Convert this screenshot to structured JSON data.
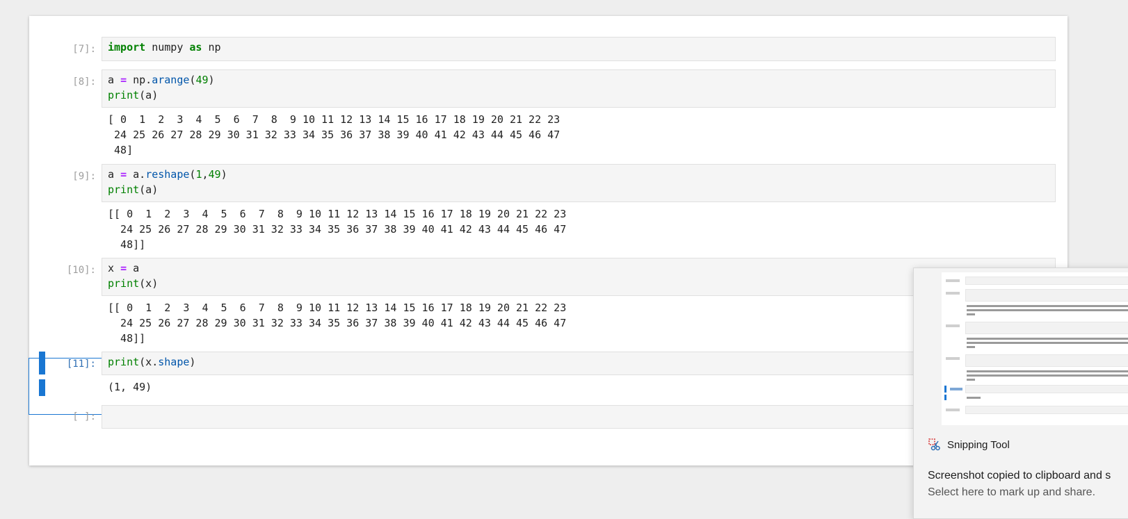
{
  "cells": [
    {
      "prompt": "[7]:",
      "input_lines": [
        [
          {
            "t": "import",
            "c": "kw"
          },
          {
            "t": " numpy "
          },
          {
            "t": "as",
            "c": "kw"
          },
          {
            "t": " np"
          }
        ]
      ],
      "output": ""
    },
    {
      "prompt": "[8]:",
      "input_lines": [
        [
          {
            "t": "a "
          },
          {
            "t": "=",
            "c": "op"
          },
          {
            "t": " np."
          },
          {
            "t": "arange",
            "c": "attr"
          },
          {
            "t": "("
          },
          {
            "t": "49",
            "c": "num"
          },
          {
            "t": ")"
          }
        ],
        [
          {
            "t": "print",
            "c": "fn"
          },
          {
            "t": "(a)"
          }
        ]
      ],
      "output": "[ 0  1  2  3  4  5  6  7  8  9 10 11 12 13 14 15 16 17 18 19 20 21 22 23\n 24 25 26 27 28 29 30 31 32 33 34 35 36 37 38 39 40 41 42 43 44 45 46 47\n 48]"
    },
    {
      "prompt": "[9]:",
      "input_lines": [
        [
          {
            "t": "a "
          },
          {
            "t": "=",
            "c": "op"
          },
          {
            "t": " a."
          },
          {
            "t": "reshape",
            "c": "attr"
          },
          {
            "t": "("
          },
          {
            "t": "1",
            "c": "num"
          },
          {
            "t": ","
          },
          {
            "t": "49",
            "c": "num"
          },
          {
            "t": ")"
          }
        ],
        [
          {
            "t": "print",
            "c": "fn"
          },
          {
            "t": "(a)"
          }
        ]
      ],
      "output": "[[ 0  1  2  3  4  5  6  7  8  9 10 11 12 13 14 15 16 17 18 19 20 21 22 23\n  24 25 26 27 28 29 30 31 32 33 34 35 36 37 38 39 40 41 42 43 44 45 46 47\n  48]]"
    },
    {
      "prompt": "[10]:",
      "input_lines": [
        [
          {
            "t": "x "
          },
          {
            "t": "=",
            "c": "op"
          },
          {
            "t": " a"
          }
        ],
        [
          {
            "t": "print",
            "c": "fn"
          },
          {
            "t": "(x)"
          }
        ]
      ],
      "output": "[[ 0  1  2  3  4  5  6  7  8  9 10 11 12 13 14 15 16 17 18 19 20 21 22 23\n  24 25 26 27 28 29 30 31 32 33 34 35 36 37 38 39 40 41 42 43 44 45 46 47\n  48]]"
    },
    {
      "prompt": "[11]:",
      "input_lines": [
        [
          {
            "t": "print",
            "c": "fn"
          },
          {
            "t": "(x."
          },
          {
            "t": "shape",
            "c": "attr"
          },
          {
            "t": ")"
          }
        ]
      ],
      "output": "(1, 49)"
    },
    {
      "prompt": "[ ]:",
      "input_lines": [
        [
          {
            "t": ""
          }
        ]
      ],
      "output": ""
    }
  ],
  "toast": {
    "app_name": "Snipping Tool",
    "title": "Screenshot copied to clipboard and s",
    "subtitle": "Select here to mark up and share.",
    "icon": "scissors-icon"
  },
  "colors": {
    "active": "#1976d2",
    "keyword": "#008000",
    "operator": "#aa22ff",
    "attribute": "#0055aa"
  }
}
